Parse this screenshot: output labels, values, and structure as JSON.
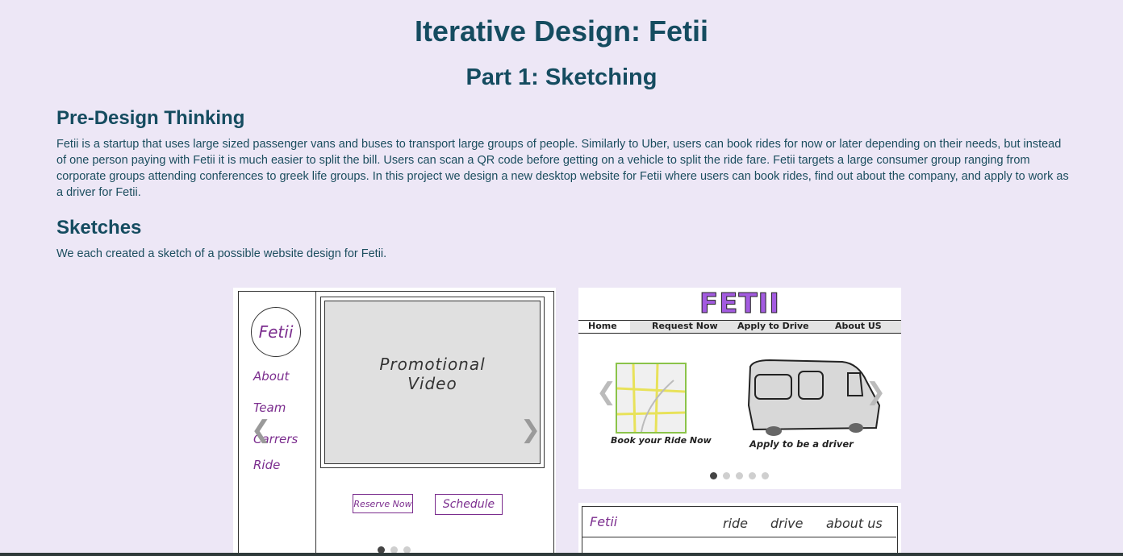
{
  "header": {
    "title": "Iterative Design: Fetii",
    "subtitle": "Part 1: Sketching"
  },
  "predesign": {
    "heading": "Pre-Design Thinking",
    "text": "Fetii is a startup that uses large sized passenger vans and buses to transport large groups of people. Similarly to Uber, users can book rides for now or later depending on their needs, but instead of one person paying with Fetii it is much easier to split the bill. Users can scan a QR code before getting on a vehicle to split the ride fare. Fetii targets a large consumer group ranging from corporate groups attending conferences to greek life groups. In this project we design a new desktop website for Fetii where users can book rides, find out about the company, and apply to work as a driver for Fetii."
  },
  "sketches": {
    "heading": "Sketches",
    "text": "We each created a sketch of a possible website design for Fetii."
  },
  "sketch1": {
    "logo": "Fetii",
    "nav": [
      "About",
      "Team",
      "Carrers",
      "Ride"
    ],
    "video_label_line1": "Promotional",
    "video_label_line2": "Video",
    "button1": "Reserve Now",
    "button2": "Schedule",
    "dots_count": 3,
    "active_dot": 0
  },
  "sketch2": {
    "logo": "FETII",
    "nav": [
      "Home",
      "Request Now",
      "Apply to Drive",
      "About US"
    ],
    "caption_left": "Book your Ride Now",
    "caption_right": "Apply to be a driver",
    "dots_count": 5,
    "active_dot": 0
  },
  "sketch3": {
    "logo": "Fetii",
    "nav": [
      "ride",
      "drive",
      "about us"
    ]
  },
  "colors": {
    "background": "#ede7f6",
    "heading": "#154c60",
    "text": "#1b4d5e",
    "sketch_purple": "#7b2d8e",
    "logo_purple": "#a35be0"
  }
}
